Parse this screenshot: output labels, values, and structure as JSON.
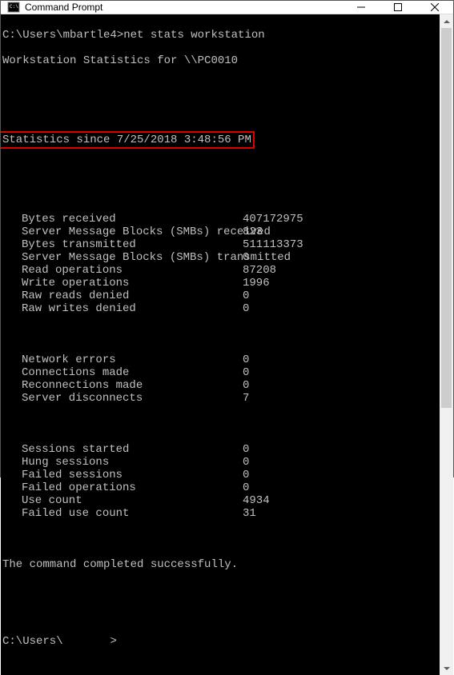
{
  "window": {
    "title": "Command Prompt"
  },
  "terminal": {
    "prompt1_path": "C:\\Users\\mbartle4>",
    "prompt1_cmd": "net stats workstation",
    "header_line": "Workstation Statistics for \\\\PC0010",
    "since_line": "Statistics since 7/25/2018 3:48:56 PM",
    "stats_group1": [
      {
        "label": "Bytes received",
        "value": "407172975"
      },
      {
        "label": "Server Message Blocks (SMBs) received",
        "value": "823"
      },
      {
        "label": "Bytes transmitted",
        "value": "511113373"
      },
      {
        "label": "Server Message Blocks (SMBs) transmitted",
        "value": "0"
      },
      {
        "label": "Read operations",
        "value": "87208"
      },
      {
        "label": "Write operations",
        "value": "1996"
      },
      {
        "label": "Raw reads denied",
        "value": "0"
      },
      {
        "label": "Raw writes denied",
        "value": "0"
      }
    ],
    "stats_group2": [
      {
        "label": "Network errors",
        "value": "0"
      },
      {
        "label": "Connections made",
        "value": "0"
      },
      {
        "label": "Reconnections made",
        "value": "0"
      },
      {
        "label": "Server disconnects",
        "value": "7"
      }
    ],
    "stats_group3": [
      {
        "label": "Sessions started",
        "value": "0"
      },
      {
        "label": "Hung sessions",
        "value": "0"
      },
      {
        "label": "Failed sessions",
        "value": "0"
      },
      {
        "label": "Failed operations",
        "value": "0"
      },
      {
        "label": "Use count",
        "value": "4934"
      },
      {
        "label": "Failed use count",
        "value": "31"
      }
    ],
    "completion_line": "The command completed successfully.",
    "prompt2_path": "C:\\Users\\",
    "prompt2_cursor": ">"
  }
}
